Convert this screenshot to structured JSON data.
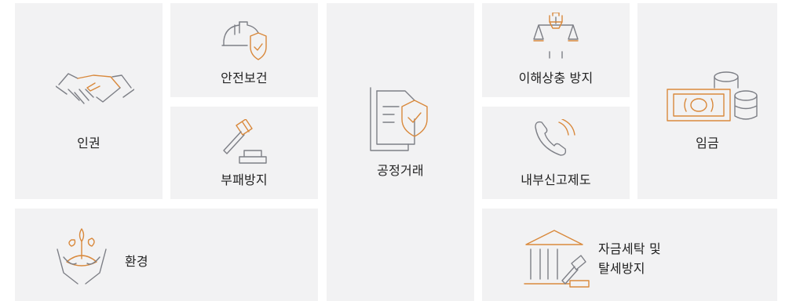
{
  "tiles": {
    "human_rights": {
      "label": "인권"
    },
    "safety_health": {
      "label": "안전보건"
    },
    "anti_corruption": {
      "label": "부패방지"
    },
    "fair_trade": {
      "label": "공정거래"
    },
    "conflict_of_interest": {
      "label": "이해상충 방지"
    },
    "whistleblowing": {
      "label": "내부신고제도"
    },
    "wages": {
      "label": "임금"
    },
    "environment": {
      "label": "환경"
    },
    "aml": {
      "label_line1": "자금세탁 및",
      "label_line2": "탈세방지"
    }
  },
  "colors": {
    "tile_bg": "#f2f2f3",
    "icon_gray": "#7d7f86",
    "accent_orange": "#d9893c"
  },
  "icons": [
    "handshake-icon",
    "hardhat-shield-icon",
    "gavel-icon",
    "document-shield-icon",
    "scales-fist-icon",
    "phone-icon",
    "money-coins-icon",
    "hands-plant-icon",
    "bank-gavel-icon"
  ]
}
